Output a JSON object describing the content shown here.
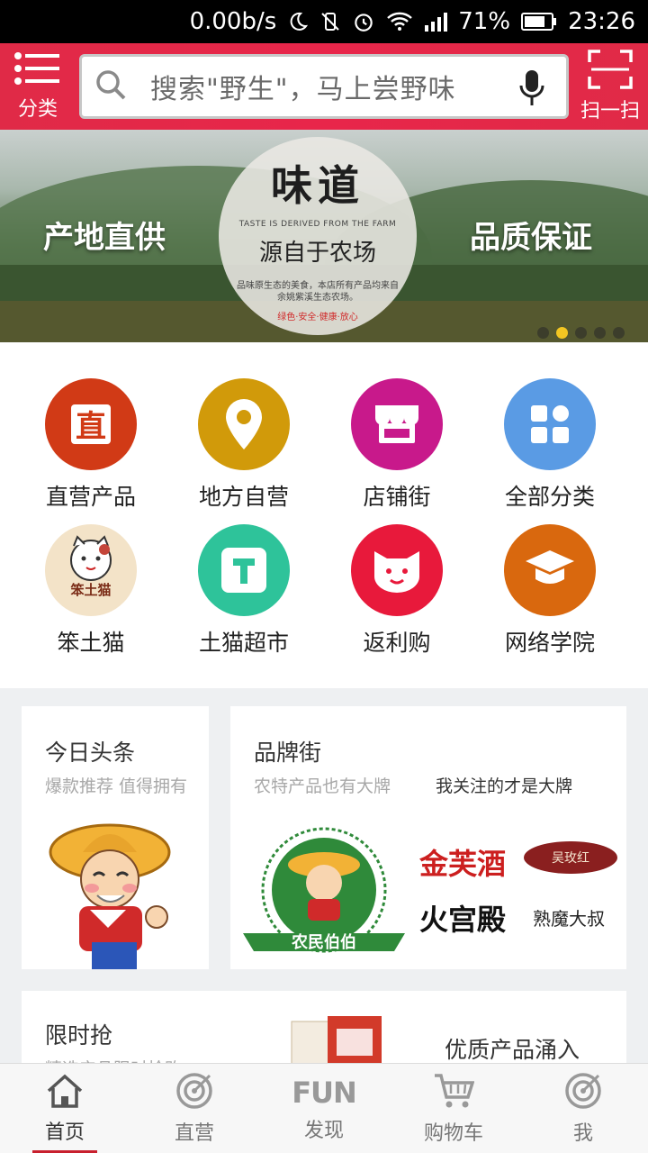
{
  "statusbar": {
    "speed": "0.00b/s",
    "battery": "71%",
    "time": "23:26"
  },
  "header": {
    "left_label": "分类",
    "search_placeholder": "搜索\"野生\"，马上尝野味",
    "right_label": "扫一扫",
    "accent": "#e8264a"
  },
  "banner": {
    "left_text": "产地直供",
    "right_text": "品质保证",
    "center_title": "味道",
    "center_en": "TASTE IS DERIVED FROM THE FARM",
    "center_sub": "源自于农场",
    "center_desc": "品味原生态的美食，本店所有产品均来自余姚紫溪生态农场。",
    "center_tags": "绿色·安全·健康·放心",
    "dots": 5,
    "active_dot": 2
  },
  "grid": [
    {
      "label": "直营产品",
      "icon": "zhi-icon",
      "color": "#d13a16"
    },
    {
      "label": "地方自营",
      "icon": "location-pin-icon",
      "color": "#d19a0a"
    },
    {
      "label": "店铺街",
      "icon": "shop-icon",
      "color": "#c8198b"
    },
    {
      "label": "全部分类",
      "icon": "grid-apps-icon",
      "color": "#5a9be4"
    },
    {
      "label": "笨土猫",
      "icon": "lucky-cat-icon",
      "color": "#f3e3c8",
      "logo_text": "笨土猫"
    },
    {
      "label": "土猫超市",
      "icon": "t-supermarket-icon",
      "color": "#2ec39a"
    },
    {
      "label": "返利购",
      "icon": "cat-face-icon",
      "color": "#e8193b"
    },
    {
      "label": "网络学院",
      "icon": "graduation-cap-icon",
      "color": "#d9680e"
    }
  ],
  "cards": {
    "today": {
      "title": "今日头条",
      "subtitle": "爆款推荐 值得拥有"
    },
    "brand": {
      "title": "品牌街",
      "subtitle": "农特产品也有大牌",
      "slogan": "我关注的才是大牌",
      "badge": "农民伯伯",
      "logos": [
        "金芙酒",
        "吴玫红",
        "火宫殿",
        "熟魔大叔"
      ]
    },
    "flash": {
      "title": "限时抢",
      "subtitle": "精选产品限时抢购",
      "promo": "优质产品涌入"
    }
  },
  "tabbar": [
    {
      "label": "首页",
      "icon": "home-icon",
      "active": true
    },
    {
      "label": "直营",
      "icon": "target-icon",
      "active": false
    },
    {
      "label": "发现",
      "icon": "fun-icon",
      "active": false
    },
    {
      "label": "购物车",
      "icon": "cart-icon",
      "active": false
    },
    {
      "label": "我",
      "icon": "target-icon",
      "active": false
    }
  ]
}
